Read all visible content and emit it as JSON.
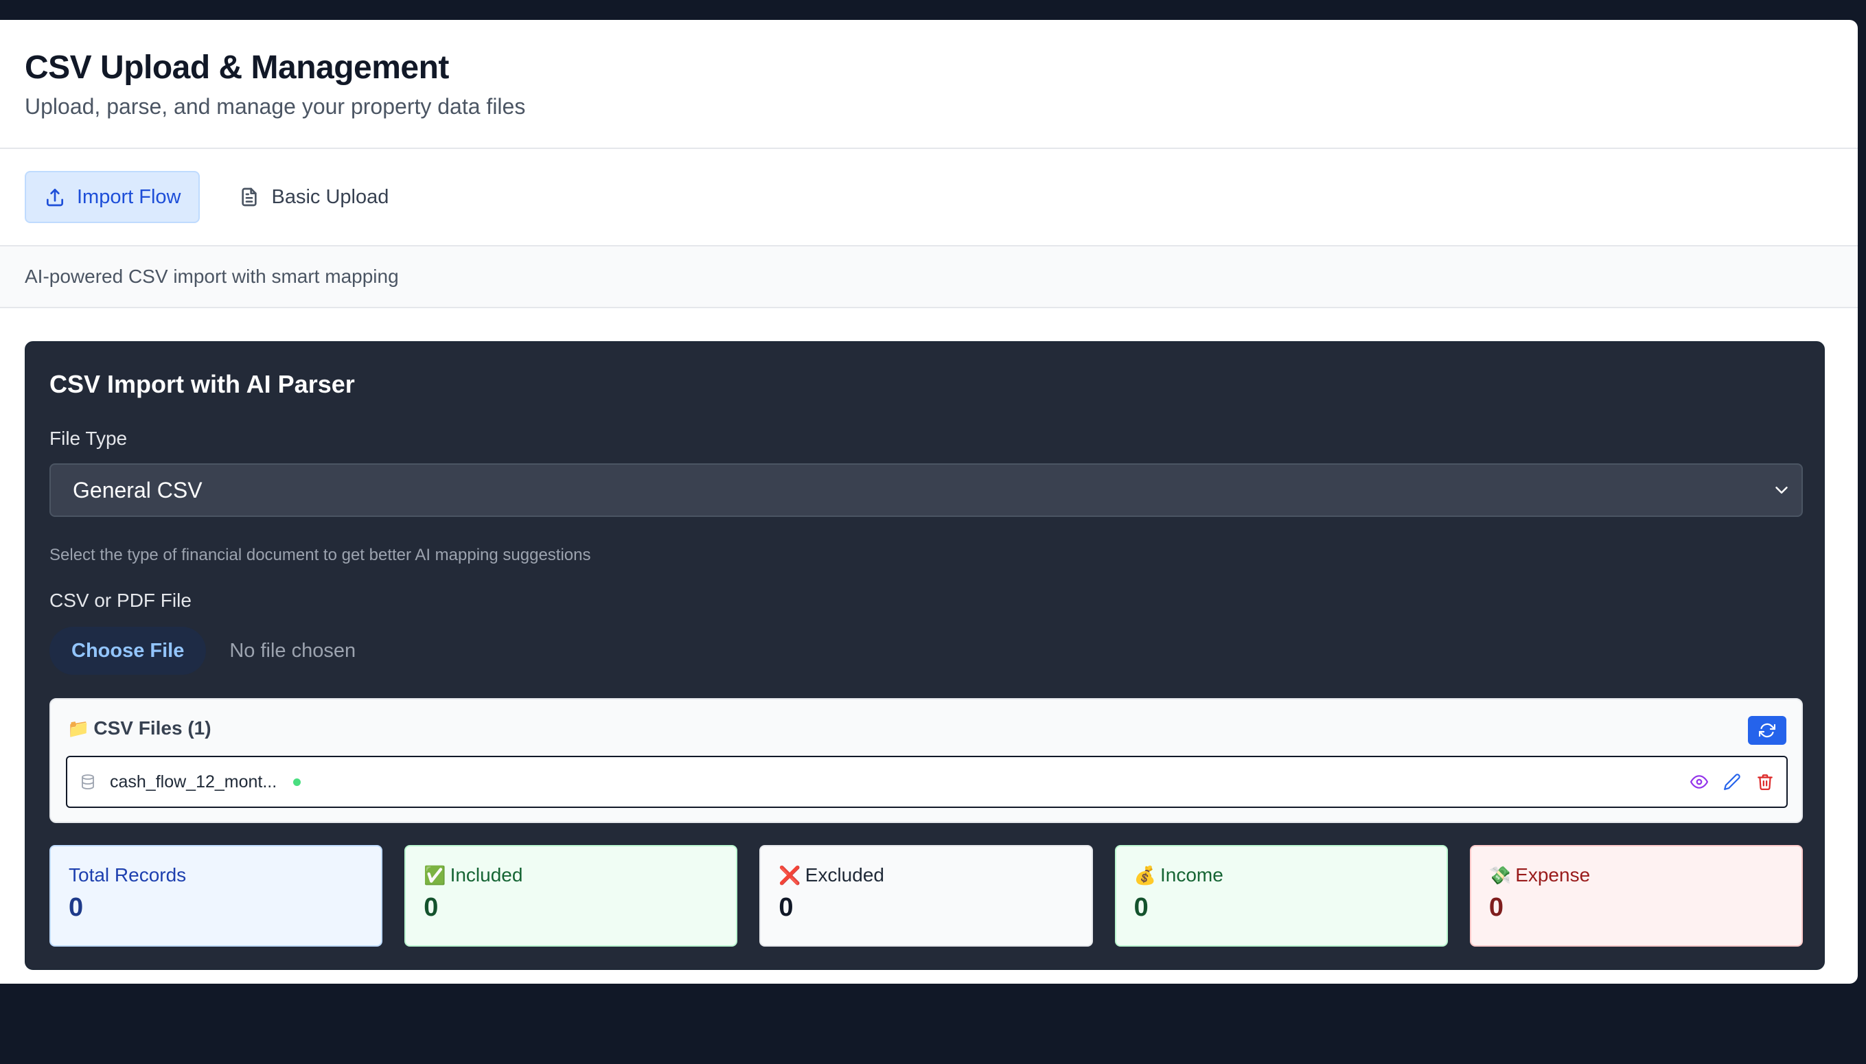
{
  "header": {
    "title": "CSV Upload & Management",
    "subtitle": "Upload, parse, and manage your property data files"
  },
  "tabs": [
    {
      "label": "Import Flow",
      "icon": "upload-icon",
      "active": true
    },
    {
      "label": "Basic Upload",
      "icon": "document-icon",
      "active": false
    }
  ],
  "tab_description": "AI-powered CSV import with smart mapping",
  "importer": {
    "title": "CSV Import with AI Parser",
    "file_type_label": "File Type",
    "file_type_value": "General CSV",
    "file_type_help": "Select the type of financial document to get better AI mapping suggestions",
    "file_label": "CSV or PDF File",
    "choose_file_label": "Choose File",
    "no_file_text": "No file chosen"
  },
  "files": {
    "header_icon": "📁",
    "header": "CSV Files (1)",
    "items": [
      {
        "name": "cash_flow_12_mont...",
        "status_color": "#4ade80"
      }
    ]
  },
  "stats": [
    {
      "emoji": "",
      "label": "Total Records",
      "value": "0",
      "color": "blue"
    },
    {
      "emoji": "✅",
      "label": "Included",
      "value": "0",
      "color": "green"
    },
    {
      "emoji": "❌",
      "label": "Excluded",
      "value": "0",
      "color": "gray"
    },
    {
      "emoji": "💰",
      "label": "Income",
      "value": "0",
      "color": "green"
    },
    {
      "emoji": "💸",
      "label": "Expense",
      "value": "0",
      "color": "red"
    }
  ],
  "colors": {
    "accent": "#2563eb",
    "panel": "#232a38",
    "backdrop": "#111827"
  }
}
